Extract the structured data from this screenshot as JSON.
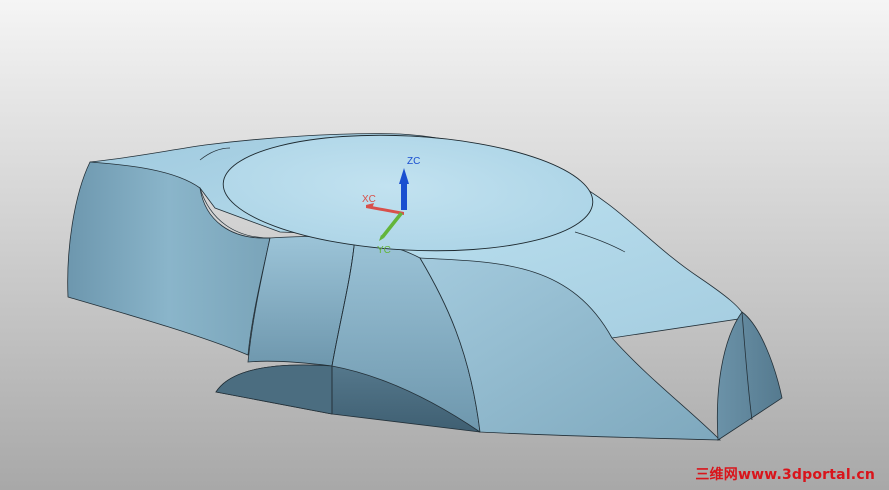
{
  "viewport": {
    "background_top": "#f4f4f4",
    "background_bottom": "#a9a9a9"
  },
  "model": {
    "face_color": "#8fb9cf",
    "top_color": "#b3d9e9",
    "shadow_color": "#4c6e82",
    "edge_color": "#1e2a30"
  },
  "triad": {
    "zc": {
      "label": "ZC",
      "color": "#1a4fd0"
    },
    "xc": {
      "label": "XC",
      "color": "#d8504a"
    },
    "yc": {
      "label": "YC",
      "color": "#63b53a"
    }
  },
  "watermark": {
    "text": "三维网www.3dportal.cn",
    "color": "#d9141b"
  }
}
